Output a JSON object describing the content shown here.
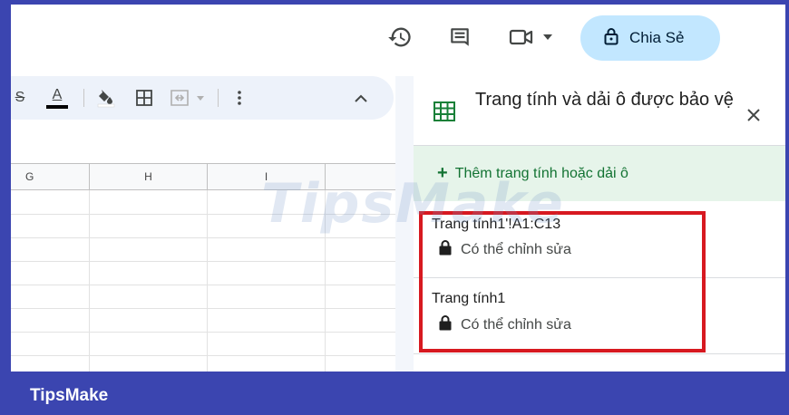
{
  "header": {
    "share_label": "Chia Sẻ",
    "icons": [
      "history-icon",
      "comment-icon",
      "video-call-icon",
      "caret-down-icon",
      "lock-icon"
    ]
  },
  "toolbar": {
    "icons": [
      "strikethrough-icon",
      "text-color-icon",
      "fill-color-icon",
      "borders-icon",
      "merge-cells-icon",
      "more-vert-icon",
      "chevron-up-icon"
    ],
    "strike_glyph": "S",
    "text_color_glyph": "A",
    "text_color": "#000000"
  },
  "grid": {
    "columns": [
      "G",
      "H",
      "I"
    ]
  },
  "panel": {
    "title": "Trang tính và dải ô được bảo vệ",
    "add_label": "Thêm trang tính hoặc dải ô",
    "items": [
      {
        "title": "Trang tính1'!A1:C13",
        "status": "Có thể chỉnh sửa"
      },
      {
        "title": "Trang tính1",
        "status": "Có thể chỉnh sửa"
      }
    ]
  },
  "watermark": "TipsMake",
  "footer": {
    "brand": "TipsMake"
  },
  "colors": {
    "frame": "#3b45b0",
    "share_bg": "#c2e7ff",
    "add_bg": "#e6f4ea",
    "add_text": "#137333",
    "highlight": "#d71920",
    "sheets_green": "#188038"
  }
}
